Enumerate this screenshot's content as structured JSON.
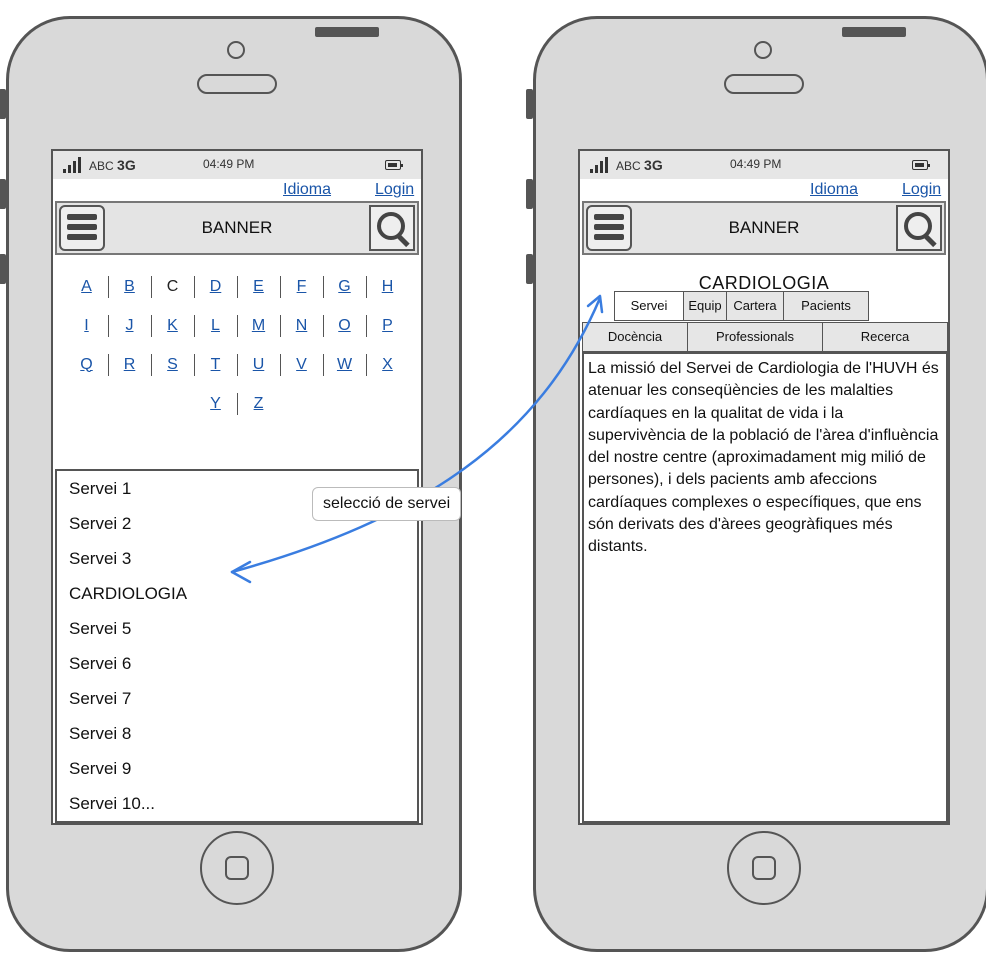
{
  "left_phone": {
    "status": {
      "carrier": "ABC",
      "network": "3G",
      "time": "04:49 PM"
    },
    "links": {
      "idioma": "Idioma",
      "login": "Login"
    },
    "banner": "BANNER",
    "alphabet_rows": [
      [
        "A",
        "B",
        "C",
        "D",
        "E",
        "F",
        "G",
        "H"
      ],
      [
        "I",
        "J",
        "K",
        "L",
        "M",
        "N",
        "O",
        "P"
      ],
      [
        "Q",
        "R",
        "S",
        "T",
        "U",
        "V",
        "W",
        "X"
      ],
      [
        "Y",
        "Z"
      ]
    ],
    "current_letter": "C",
    "services": [
      "Servei 1",
      "Servei 2",
      "Servei 3",
      "CARDIOLOGIA",
      "Servei 5",
      "Servei 6",
      "Servei 7",
      "Servei 8",
      "Servei 9",
      "Servei 10..."
    ]
  },
  "right_phone": {
    "status": {
      "carrier": "ABC",
      "network": "3G",
      "time": "04:49 PM"
    },
    "links": {
      "idioma": "Idioma",
      "login": "Login"
    },
    "banner": "BANNER",
    "department": "CARDIOLOGIA",
    "tabs_row1": [
      "Servei",
      "Equip",
      "Cartera",
      "Pacients"
    ],
    "tabs_row2": [
      "Docència",
      "Professionals",
      "Recerca"
    ],
    "active_tab": "Servei",
    "content": "La missió del Servei de Cardiologia de l'HUVH és atenuar les conseqüències de les malalties cardíaques en la qualitat de vida i la supervivència de la població de l'àrea d'influència del nostre centre (aproximadament mig milió de persones), i dels pacients amb afeccions cardíaques complexes o específiques, que ens són derivats des d'àrees geogràfiques més distants."
  },
  "annotation": {
    "label": "selecció de servei",
    "color": "#3a7de0"
  },
  "colors": {
    "link": "#1a55a8",
    "phone_body": "#d9d9d9",
    "outline": "#555555"
  }
}
